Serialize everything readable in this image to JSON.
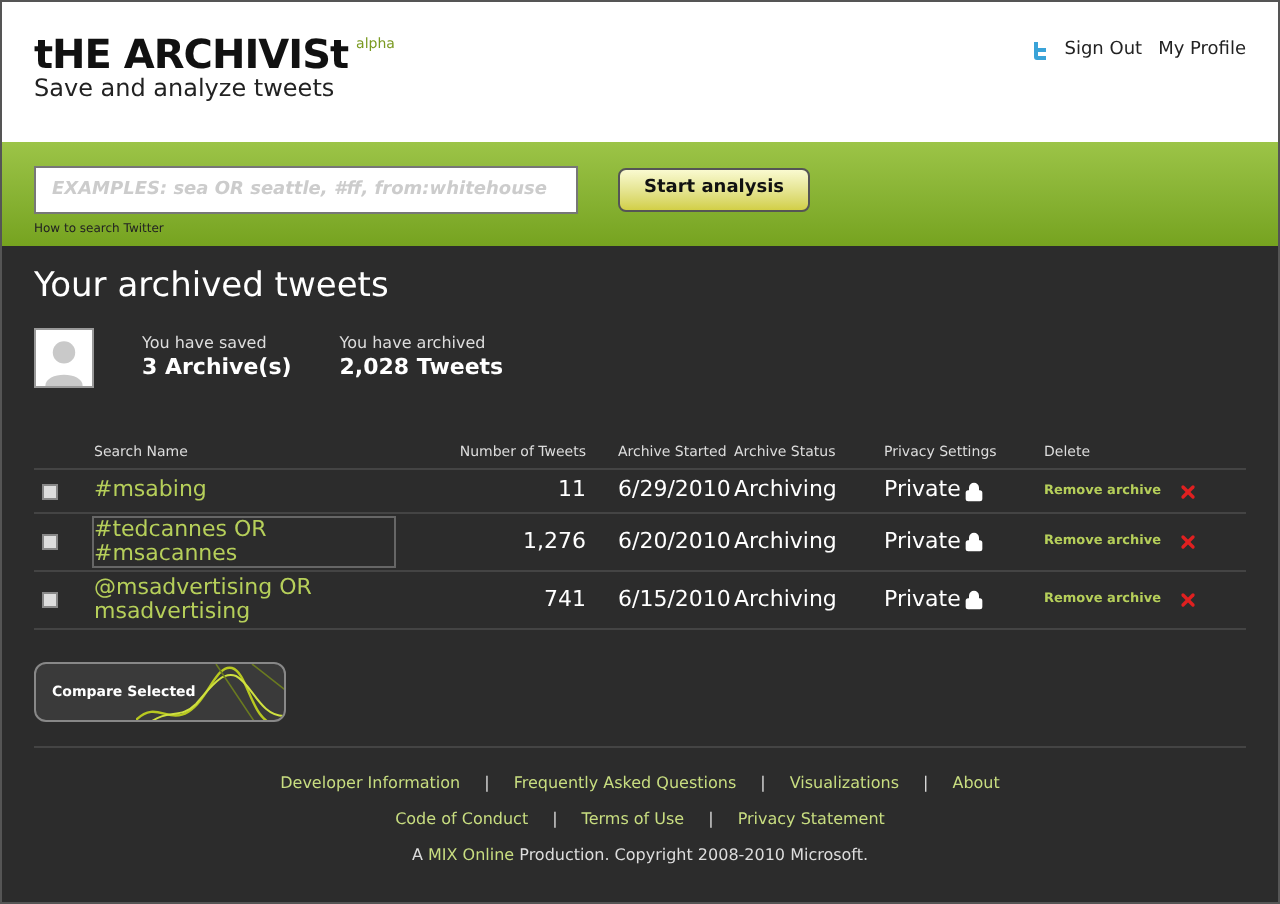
{
  "header": {
    "logo": "tHE ARCHIVISt",
    "badge": "alpha",
    "tagline": "Save and analyze tweets",
    "links": [
      "Sign Out",
      "My Profile"
    ]
  },
  "search": {
    "placeholder": "EXAMPLES: sea OR seattle, #ff, from:whitehouse",
    "help": "How to search Twitter",
    "button": "Start analysis"
  },
  "main": {
    "title": "Your archived tweets",
    "stats": [
      {
        "label": "You have saved",
        "value": "3 Archive(s)"
      },
      {
        "label": "You have archived",
        "value": "2,028 Tweets"
      }
    ]
  },
  "table": {
    "columns": [
      "Search Name",
      "Number of Tweets",
      "Archive Started",
      "Archive Status",
      "Privacy Settings",
      "Delete"
    ],
    "rows": [
      {
        "checked": false,
        "focused": false,
        "name": "#msabing",
        "count": "11",
        "started": "6/29/2010",
        "status": "Archiving",
        "privacy": "Private",
        "delete": "Remove archive"
      },
      {
        "checked": false,
        "focused": true,
        "name": "#tedcannes OR #msacannes",
        "count": "1,276",
        "started": "6/20/2010",
        "status": "Archiving",
        "privacy": "Private",
        "delete": "Remove archive"
      },
      {
        "checked": false,
        "focused": false,
        "name": "@msadvertising OR msadvertising",
        "count": "741",
        "started": "6/15/2010",
        "status": "Archiving",
        "privacy": "Private",
        "delete": "Remove archive"
      }
    ]
  },
  "compare_button": "Compare Selected",
  "footer": {
    "lines": [
      [
        {
          "kind": "link",
          "text": "Developer Information"
        },
        {
          "kind": "separator",
          "text": "|"
        },
        {
          "kind": "link",
          "text": "Frequently Asked Questions"
        },
        {
          "kind": "separator",
          "text": "|"
        },
        {
          "kind": "link",
          "text": "Visualizations"
        },
        {
          "kind": "separator",
          "text": "|"
        },
        {
          "kind": "link",
          "text": "About"
        }
      ],
      [
        {
          "kind": "link",
          "text": "Code of Conduct"
        },
        {
          "kind": "separator",
          "text": "|"
        },
        {
          "kind": "link",
          "text": "Terms of Use"
        },
        {
          "kind": "separator",
          "text": "|"
        },
        {
          "kind": "link",
          "text": "Privacy Statement"
        }
      ]
    ],
    "copyright": {
      "before": "A ",
      "link": "MIX Online",
      "after": " Production. Copyright 2008-2010 Microsoft."
    }
  }
}
